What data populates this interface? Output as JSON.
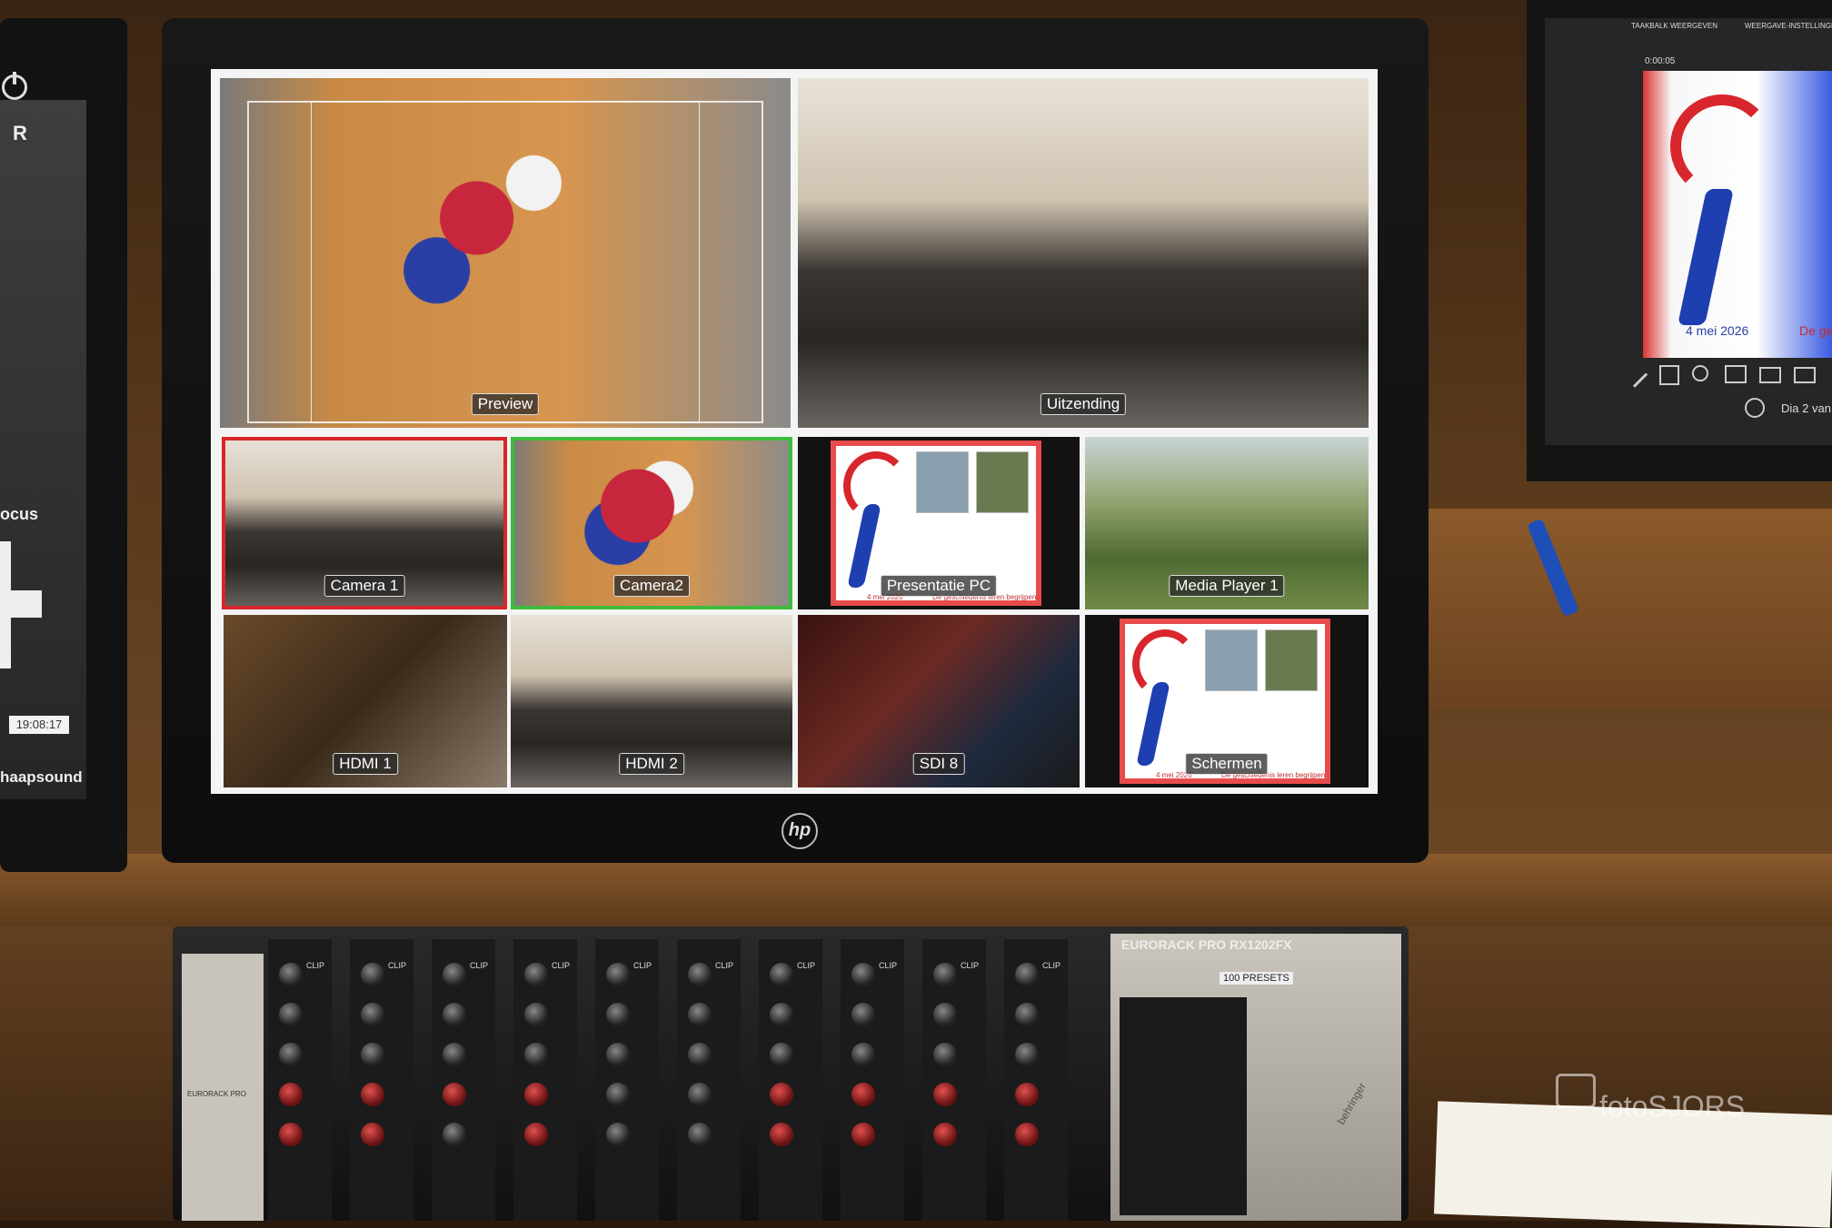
{
  "left_monitor": {
    "letter": "R",
    "focus_text": "ocus",
    "time": "19:08:17",
    "footer_text": "haapsound"
  },
  "multiview": {
    "large_tiles": [
      {
        "label": "Preview"
      },
      {
        "label": "Uitzending"
      }
    ],
    "small_tiles": [
      {
        "label": "Camera 1",
        "border": "#d8262c"
      },
      {
        "label": "Camera2",
        "border": "#3dbb3d"
      },
      {
        "label": "Presentatie PC",
        "border": ""
      },
      {
        "label": "Media Player 1",
        "border": ""
      },
      {
        "label": "HDMI 1",
        "border": ""
      },
      {
        "label": "HDMI 2",
        "border": ""
      },
      {
        "label": "SDI 8",
        "border": ""
      },
      {
        "label": "Schermen",
        "border": ""
      }
    ],
    "slide": {
      "date": "4 mei 2026",
      "caption": "De geschiedenis leren begrijpen"
    }
  },
  "monitor_brand": "hp",
  "right_monitor": {
    "menu_1": "TAAKBALK WEERGEVEN",
    "menu_2": "WEERGAVE-INSTELLINGEN",
    "timer": "0:00:05",
    "date": "4 mei 2026",
    "date_cut": "De ge",
    "slide_counter": "Dia 2 van"
  },
  "mixer": {
    "model": "EURORACK PRO RX1202FX",
    "presets": "100 PRESETS",
    "left_label": "EURORACK PRO",
    "brand": "behringer",
    "clip_label": "CLIP"
  },
  "watermark": "fotoSJORS",
  "colors": {
    "preview_border": "#d8262c",
    "program_border": "#3dbb3d",
    "label_bg": "#333333"
  }
}
